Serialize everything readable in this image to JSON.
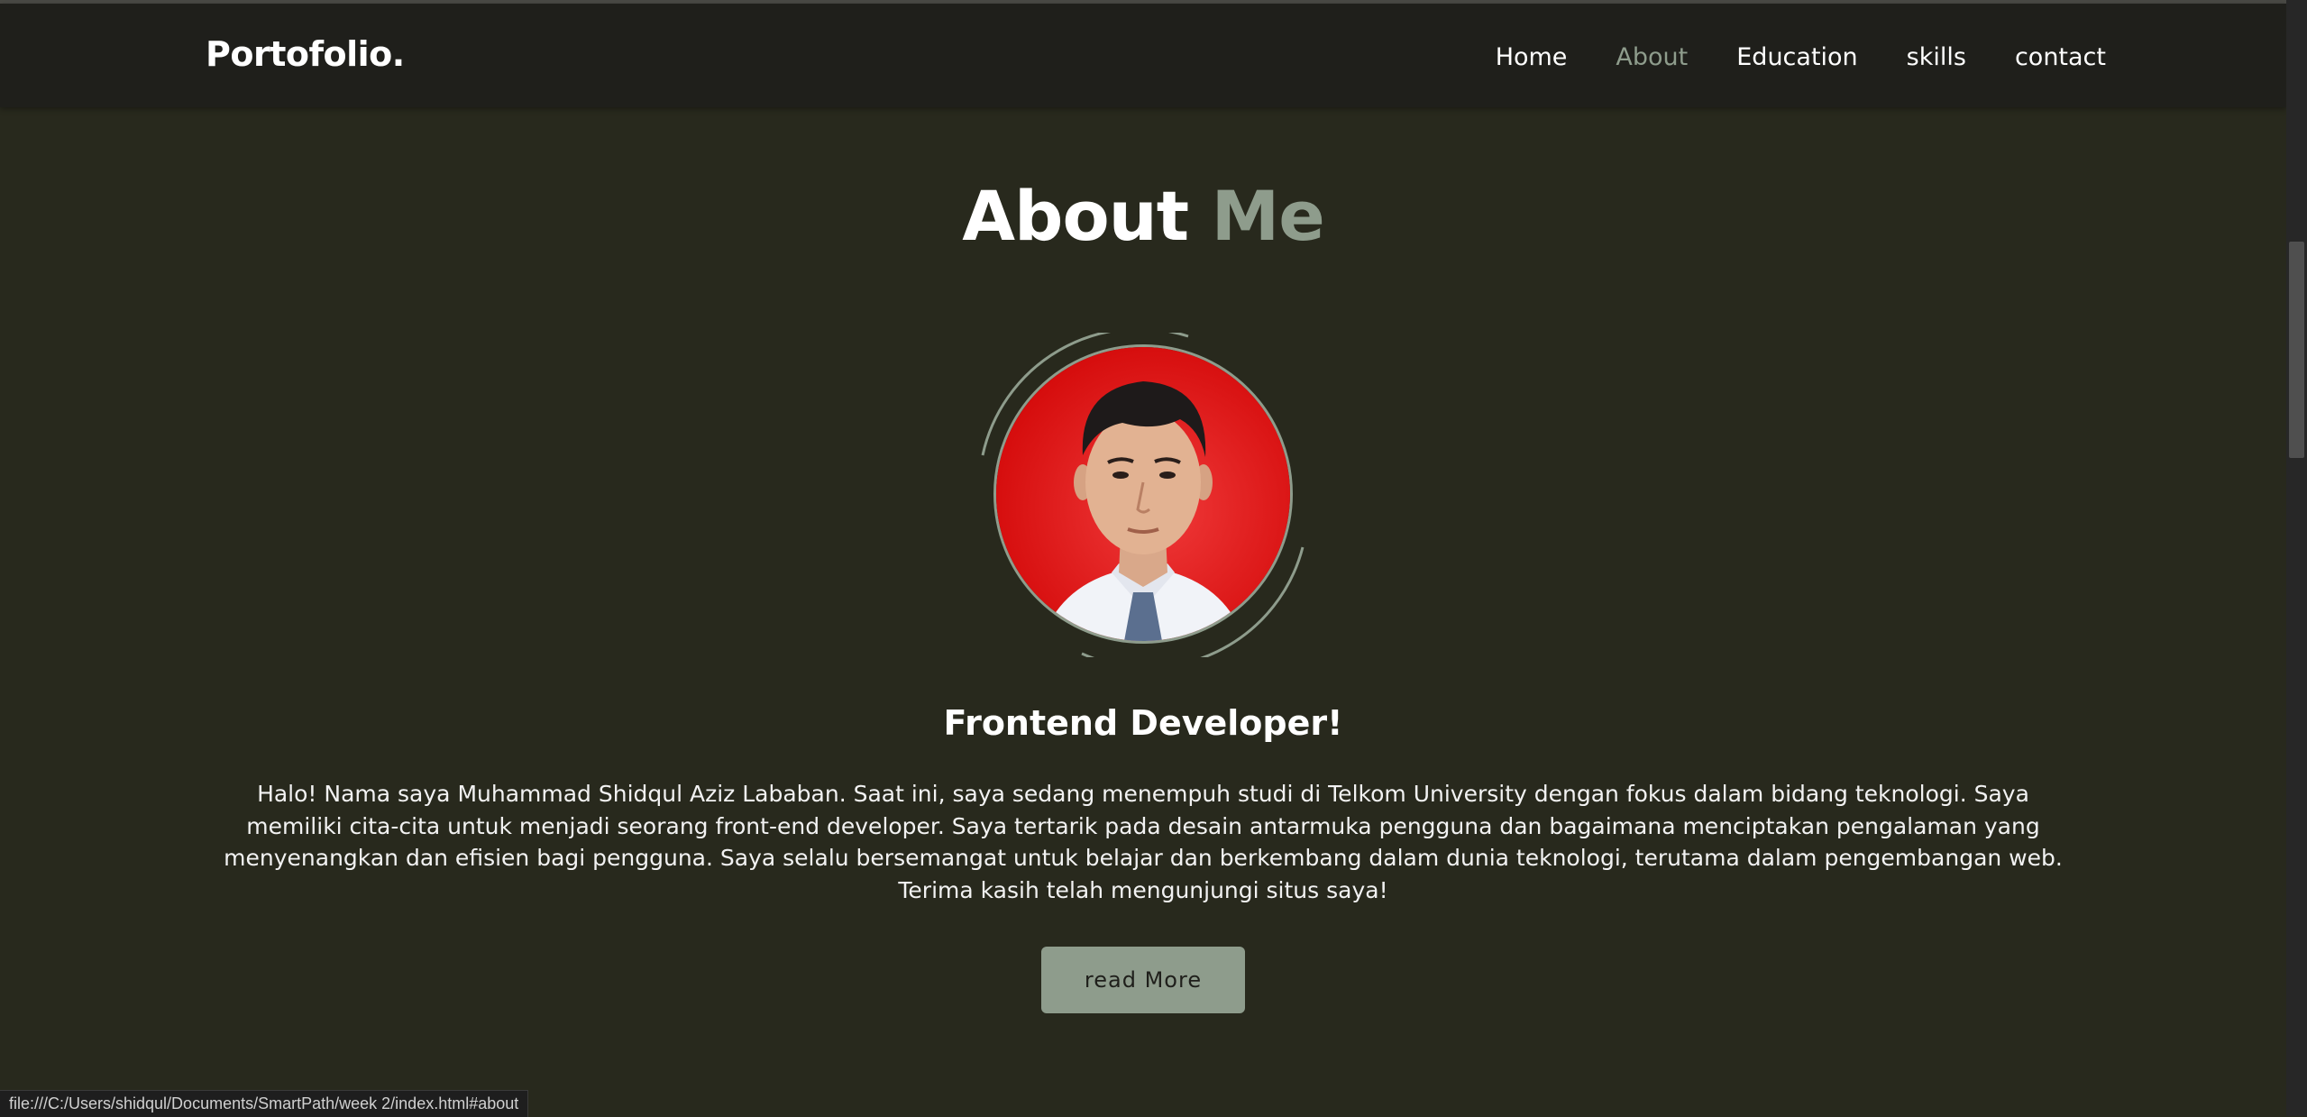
{
  "nav": {
    "brand": "Portofolio.",
    "items": [
      {
        "label": "Home",
        "active": false
      },
      {
        "label": "About",
        "active": true
      },
      {
        "label": "Education",
        "active": false
      },
      {
        "label": "skills",
        "active": false
      },
      {
        "label": "contact",
        "active": false
      }
    ]
  },
  "about": {
    "heading_main": "About",
    "heading_accent": "Me",
    "subtitle": "Frontend Developer!",
    "description": "Halo! Nama saya Muhammad Shidqul Aziz Lababan. Saat ini, saya sedang menempuh studi di Telkom University dengan fokus dalam bidang teknologi. Saya memiliki cita-cita untuk menjadi seorang front-end developer. Saya tertarik pada desain antarmuka pengguna dan bagaimana menciptakan pengalaman yang menyenangkan dan efisien bagi pengguna. Saya selalu bersemangat untuk belajar dan berkembang dalam dunia teknologi, terutama dalam pengembangan web. Terima kasih telah mengunjungi situs saya!",
    "button_label": "read More"
  },
  "status_bar": {
    "url": "file:///C:/Users/shidqul/Documents/SmartPath/week 2/index.html#about"
  },
  "colors": {
    "background": "#28291d",
    "navbar": "#1f1f1b",
    "accent": "#8e9c8c",
    "photo_background": "#d90d0d"
  }
}
